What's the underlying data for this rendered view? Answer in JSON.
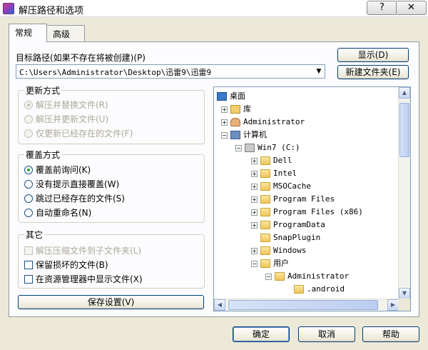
{
  "window": {
    "title": "解压路径和选项",
    "help_button": "?",
    "close_button": "✕"
  },
  "tabs": [
    {
      "label": "常规"
    },
    {
      "label": "高级"
    }
  ],
  "target": {
    "label": "目标路径(如果不存在将被创建)(P)",
    "value": "C:\\Users\\Administrator\\Desktop\\迅雷9\\迅雷9",
    "show_button": "显示(D)",
    "new_folder_button": "新建文件夹(E)"
  },
  "update_mode": {
    "title": "更新方式",
    "options": [
      {
        "label": "解压并替换文件(R)",
        "checked": true
      },
      {
        "label": "解压并更新文件(U)",
        "checked": false
      },
      {
        "label": "仅更新已经存在的文件(F)",
        "checked": false
      }
    ]
  },
  "overwrite_mode": {
    "title": "覆盖方式",
    "options": [
      {
        "label": "覆盖前询问(K)",
        "checked": true
      },
      {
        "label": "没有提示直接覆盖(W)",
        "checked": false
      },
      {
        "label": "跳过已经存在的文件(S)",
        "checked": false
      },
      {
        "label": "自动重命名(N)",
        "checked": false
      }
    ]
  },
  "misc": {
    "title": "其它",
    "options": [
      {
        "label": "解压压缩文件到子文件夹(L)",
        "checked": false
      },
      {
        "label": "保留损坏的文件(B)",
        "checked": false
      },
      {
        "label": "在资源管理器中显示文件(X)",
        "checked": false
      }
    ]
  },
  "save_settings_button": "保存设置(V)",
  "tree": {
    "nodes": [
      {
        "label": "桌面",
        "icon": "desktop-icon",
        "expander": ""
      },
      {
        "label": "库",
        "icon": "library-icon",
        "expander": "+"
      },
      {
        "label": "Administrator",
        "icon": "user-icon",
        "expander": "+"
      },
      {
        "label": "计算机",
        "icon": "computer-icon",
        "expander": "−"
      },
      {
        "label": "Win7 (C:)",
        "icon": "drive-icon",
        "expander": "−"
      },
      {
        "label": "Dell",
        "icon": "folder-icon",
        "expander": "+"
      },
      {
        "label": "Intel",
        "icon": "folder-icon",
        "expander": "+"
      },
      {
        "label": "MSOCache",
        "icon": "folder-icon",
        "expander": "+"
      },
      {
        "label": "Program Files",
        "icon": "folder-icon",
        "expander": "+"
      },
      {
        "label": "Program Files (x86)",
        "icon": "folder-icon",
        "expander": "+"
      },
      {
        "label": "ProgramData",
        "icon": "folder-icon",
        "expander": "+"
      },
      {
        "label": "SnapPlugin",
        "icon": "folder-icon",
        "expander": ""
      },
      {
        "label": "Windows",
        "icon": "folder-icon",
        "expander": "+"
      },
      {
        "label": "用户",
        "icon": "folder-icon",
        "expander": "−"
      },
      {
        "label": "Administrator",
        "icon": "folder-icon",
        "expander": "−"
      },
      {
        "label": ".android",
        "icon": "folder-icon",
        "expander": ""
      }
    ]
  },
  "footer": {
    "ok": "确定",
    "cancel": "取消",
    "help": "帮助"
  }
}
